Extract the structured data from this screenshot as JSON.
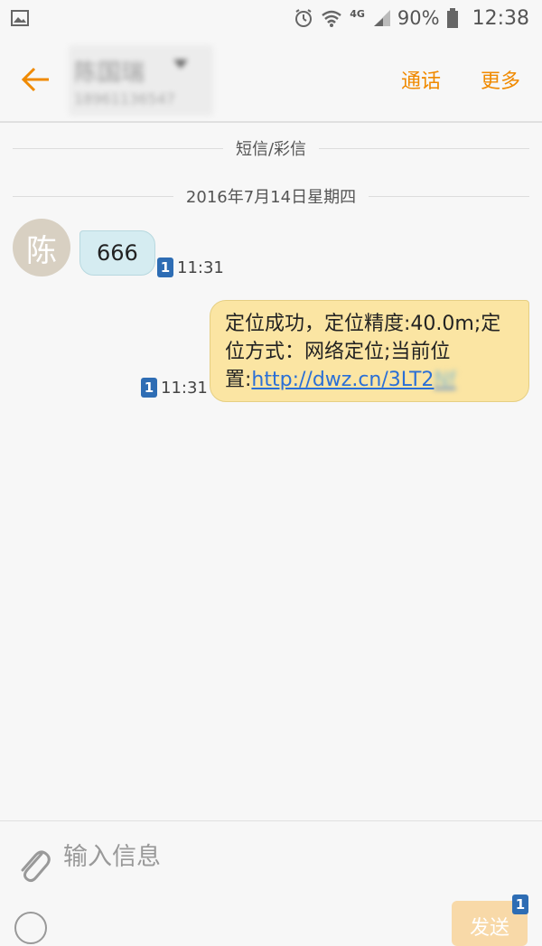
{
  "status_bar": {
    "network_label": "4G",
    "battery": "90%",
    "time": "12:38"
  },
  "header": {
    "contact_name": "陈国瑞",
    "contact_number": "18961136547",
    "call_label": "通话",
    "more_label": "更多"
  },
  "conversation": {
    "type_label": "短信/彩信",
    "date_label": "2016年7月14日星期四",
    "messages": [
      {
        "direction": "incoming",
        "avatar_letter": "陈",
        "text": "666",
        "sim": "1",
        "time": "11:31"
      },
      {
        "direction": "outgoing",
        "text": "定位成功，定位精度:40.0m;定位方式：网络定位;当前位置:",
        "link": "http://dwz.cn/3LT2",
        "link_blurred": "Nf",
        "sim": "1",
        "time": "11:31"
      }
    ]
  },
  "composer": {
    "placeholder": "输入信息",
    "send_label": "发送",
    "send_sim": "1"
  },
  "colors": {
    "accent": "#f08a00",
    "incoming_bubble": "#d5ecf1",
    "outgoing_bubble": "#fbe5a3",
    "sim_badge": "#2e6db4",
    "link": "#2a6fd6"
  }
}
